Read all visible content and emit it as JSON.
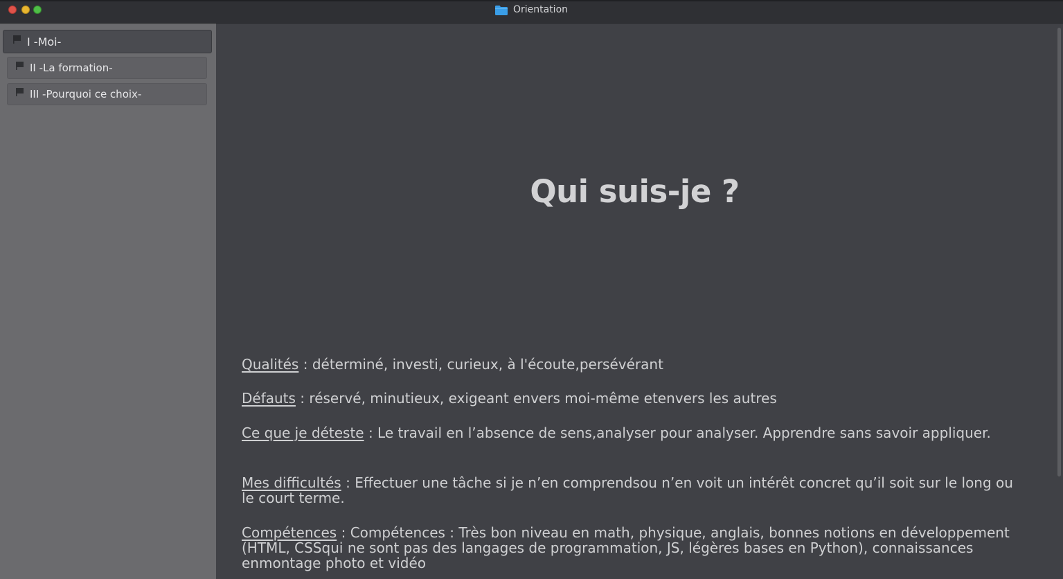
{
  "window": {
    "title": "Orientation",
    "controls": {
      "close": "×",
      "minimize": "–",
      "maximize": "+"
    }
  },
  "sidebar": {
    "items": [
      {
        "label": "I -Moi-",
        "active": true
      },
      {
        "label": "II -La formation-",
        "active": false
      },
      {
        "label": "III -Pourquoi ce choix-",
        "active": false
      }
    ]
  },
  "main": {
    "heading": "Qui suis-je ?",
    "sections": [
      {
        "label": "Qualités",
        "text": " : déterminé, investi, curieux, à l'écoute,persévérant"
      },
      {
        "label": "Défauts",
        "text": " : réservé, minutieux, exigeant envers moi-même etenvers les autres"
      },
      {
        "label": "Ce que je déteste",
        "text": " : Le travail en l’absence de sens,analyser pour analyser. Apprendre sans savoir appliquer."
      },
      {
        "label": "Mes difficultés",
        "text": " : Effectuer une tâche si je n’en comprendsou n’en voit un intérêt concret qu’il soit sur le long ou le court terme."
      },
      {
        "label": "Compétences",
        "text": " : Compétences : Très bon niveau en math, physique, anglais, bonnes notions en développement (HTML, CSSqui ne sont pas des langages de programmation, JS, légères bases en Python), connaissances enmontage photo et vidéo"
      }
    ]
  },
  "colors": {
    "sidebar_bg": "#6b6b6e",
    "content_bg": "#404146",
    "titlebar_bg": "#2f3034",
    "folder_icon": "#3a9ee8",
    "text": "#cfd0d2"
  },
  "icons": {
    "title": "folder-icon",
    "sidebar_item": "bookmark-flag-icon"
  }
}
